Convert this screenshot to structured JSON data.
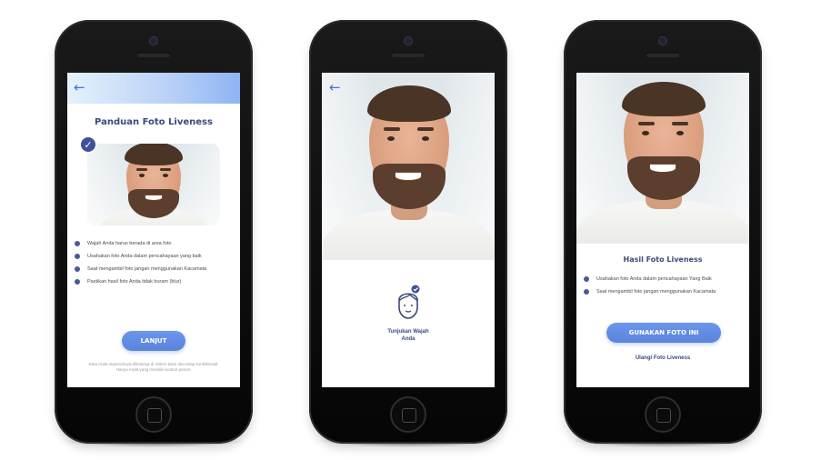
{
  "colors": {
    "accent": "#5a83dc",
    "title": "#3b4a7a",
    "bullet": "#4a5a93",
    "phone": "#0a0a0a"
  },
  "screen_guide": {
    "back_icon": "arrow-left-icon",
    "title": "Panduan Foto Liveness",
    "check_icon": "check-circle-icon",
    "instructions": [
      "Wajah Anda harus berada di area foto",
      "Usahakan foto Anda dalam pencahayaan yang baik",
      "Saat mengambil foto jangan menggunakan Kacamata",
      "Pastikan hasil foto Anda tidak buram (blur)"
    ],
    "button_label": "LANJUT",
    "footer_note": "Data Anda sepenuhnya dilindungi di sistem kami dan tetap konfidensial. Hanya Anda yang memiliki kontrol penuh."
  },
  "screen_capture": {
    "back_icon": "arrow-left-icon",
    "face_icon": "face-outline-icon",
    "label_line1": "Tunjukan Wajah",
    "label_line2": "Anda"
  },
  "screen_result": {
    "title": "Hasil Foto Liveness",
    "notes": [
      "Usahakan foto Anda dalam pencahayaan Yang Baik",
      "Saat mengambil foto jangan menggunakan Kacamata"
    ],
    "primary_button_label": "GUNAKAN FOTO INI",
    "retry_link_label": "Ulangi Foto Liveness"
  }
}
